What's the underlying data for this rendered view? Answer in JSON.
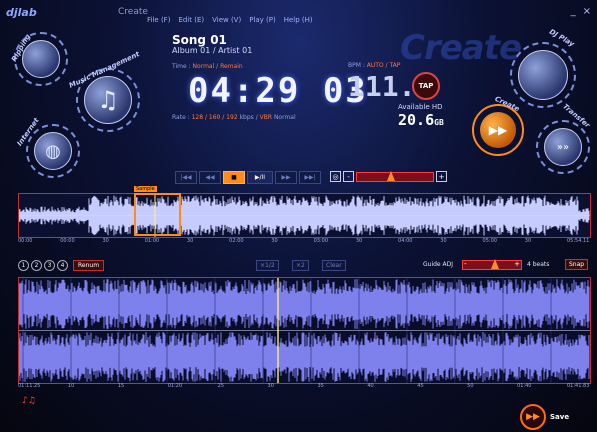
{
  "app": {
    "brand": "djlab",
    "title": "Create",
    "window_buttons": [
      "_",
      "×"
    ],
    "watermark": "Create"
  },
  "menu": [
    "File (F)",
    "Edit (E)",
    "View (V)",
    "Play (P)",
    "Help (H)"
  ],
  "song": {
    "title": "Song 01",
    "subtitle": "Album 01 / Artist 01"
  },
  "time": {
    "label": "Time :",
    "mode_normal": "Normal",
    "mode_sep": " / ",
    "mode_remain": "Remain",
    "display": "04:29 03"
  },
  "rate": {
    "label": "Rate :",
    "values": "128 / 160 / 192",
    "unit": "kbps",
    "sep": " / ",
    "vbr": "VBR",
    "mode": "Normal"
  },
  "bpm": {
    "label": "BPM :",
    "auto": "AUTO / TAP",
    "value": "111.3",
    "tap": "TAP"
  },
  "hd": {
    "label": "Available HD",
    "value": "20.6",
    "unit": "GB"
  },
  "nav": {
    "ripping": "Ripping",
    "music_management": "Music Management",
    "internet": "Internet",
    "dj_play": "DJ Play",
    "create": "Create",
    "transfer": "Transfer"
  },
  "transport": {
    "buttons": [
      "|◀◀",
      "◀◀",
      "■",
      "▶/II",
      "▶▶",
      "▶▶|"
    ],
    "active_index": 2,
    "pitch_minus": "-",
    "pitch_plus": "+",
    "pitch_level": 0.45
  },
  "overview": {
    "sample_label": "Sample",
    "times": [
      "00:00",
      "00:00",
      "30",
      "01:00",
      "30",
      "02:00",
      "30",
      "03:00",
      "30",
      "04:00",
      "30",
      "05:00",
      "30",
      "05:54.11"
    ]
  },
  "controls": {
    "nums": [
      "1",
      "2",
      "3",
      "4"
    ],
    "renum": "Renum",
    "x_half": "×1/2",
    "x_two": "×2",
    "clear": "Clear",
    "guide_label": "Guide ADJ",
    "guide_minus": "-",
    "guide_plus": "+",
    "guide_value": "4",
    "beats": "beats",
    "snap": "Snap"
  },
  "detail": {
    "times": [
      "01:11.25",
      "10",
      "15",
      "01:20",
      "25",
      "30",
      "35",
      "40",
      "45",
      "50",
      "01:40",
      "01:41.83"
    ]
  },
  "save": {
    "label": "Save"
  },
  "colors": {
    "accent": "#ff8c1a",
    "red": "#c23030",
    "wave": "#8a8cf0"
  }
}
